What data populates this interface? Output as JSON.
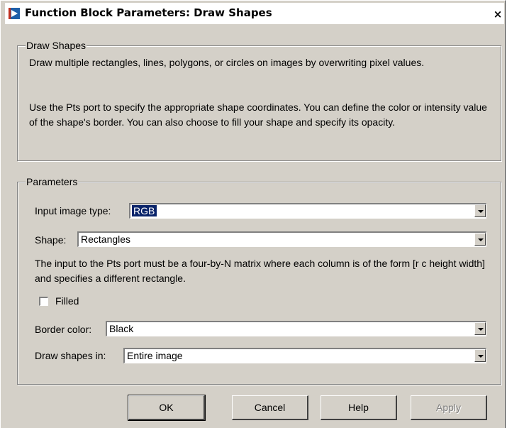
{
  "window": {
    "title": "Function Block Parameters: Draw Shapes",
    "close_label": "×"
  },
  "description": {
    "group_title": "Draw Shapes",
    "para1": "Draw multiple rectangles, lines, polygons, or circles on images by overwriting pixel values.",
    "para2": "Use the Pts port to specify the appropriate shape coordinates. You can define the color or intensity value of the shape's border. You can also choose to fill your shape and specify its opacity."
  },
  "parameters": {
    "group_title": "Parameters",
    "input_image_type": {
      "label": "Input image type:",
      "value": "RGB"
    },
    "shape": {
      "label": "Shape:",
      "value": "Rectangles"
    },
    "hint": "The input to the Pts port must be a four-by-N matrix where each column is of the form [r c height width] and specifies a different rectangle.",
    "filled": {
      "label": "Filled",
      "checked": false
    },
    "border_color": {
      "label": "Border color:",
      "value": "Black"
    },
    "draw_shapes_in": {
      "label": "Draw shapes in:",
      "value": "Entire image"
    }
  },
  "buttons": {
    "ok": "OK",
    "cancel": "Cancel",
    "help": "Help",
    "apply": "Apply"
  },
  "colors": {
    "dialog_bg": "#d4d0c8",
    "selection": "#0a246a"
  },
  "icons": {
    "app": "simulink-block-icon",
    "close": "close-icon",
    "dropdown": "chevron-down-icon"
  }
}
